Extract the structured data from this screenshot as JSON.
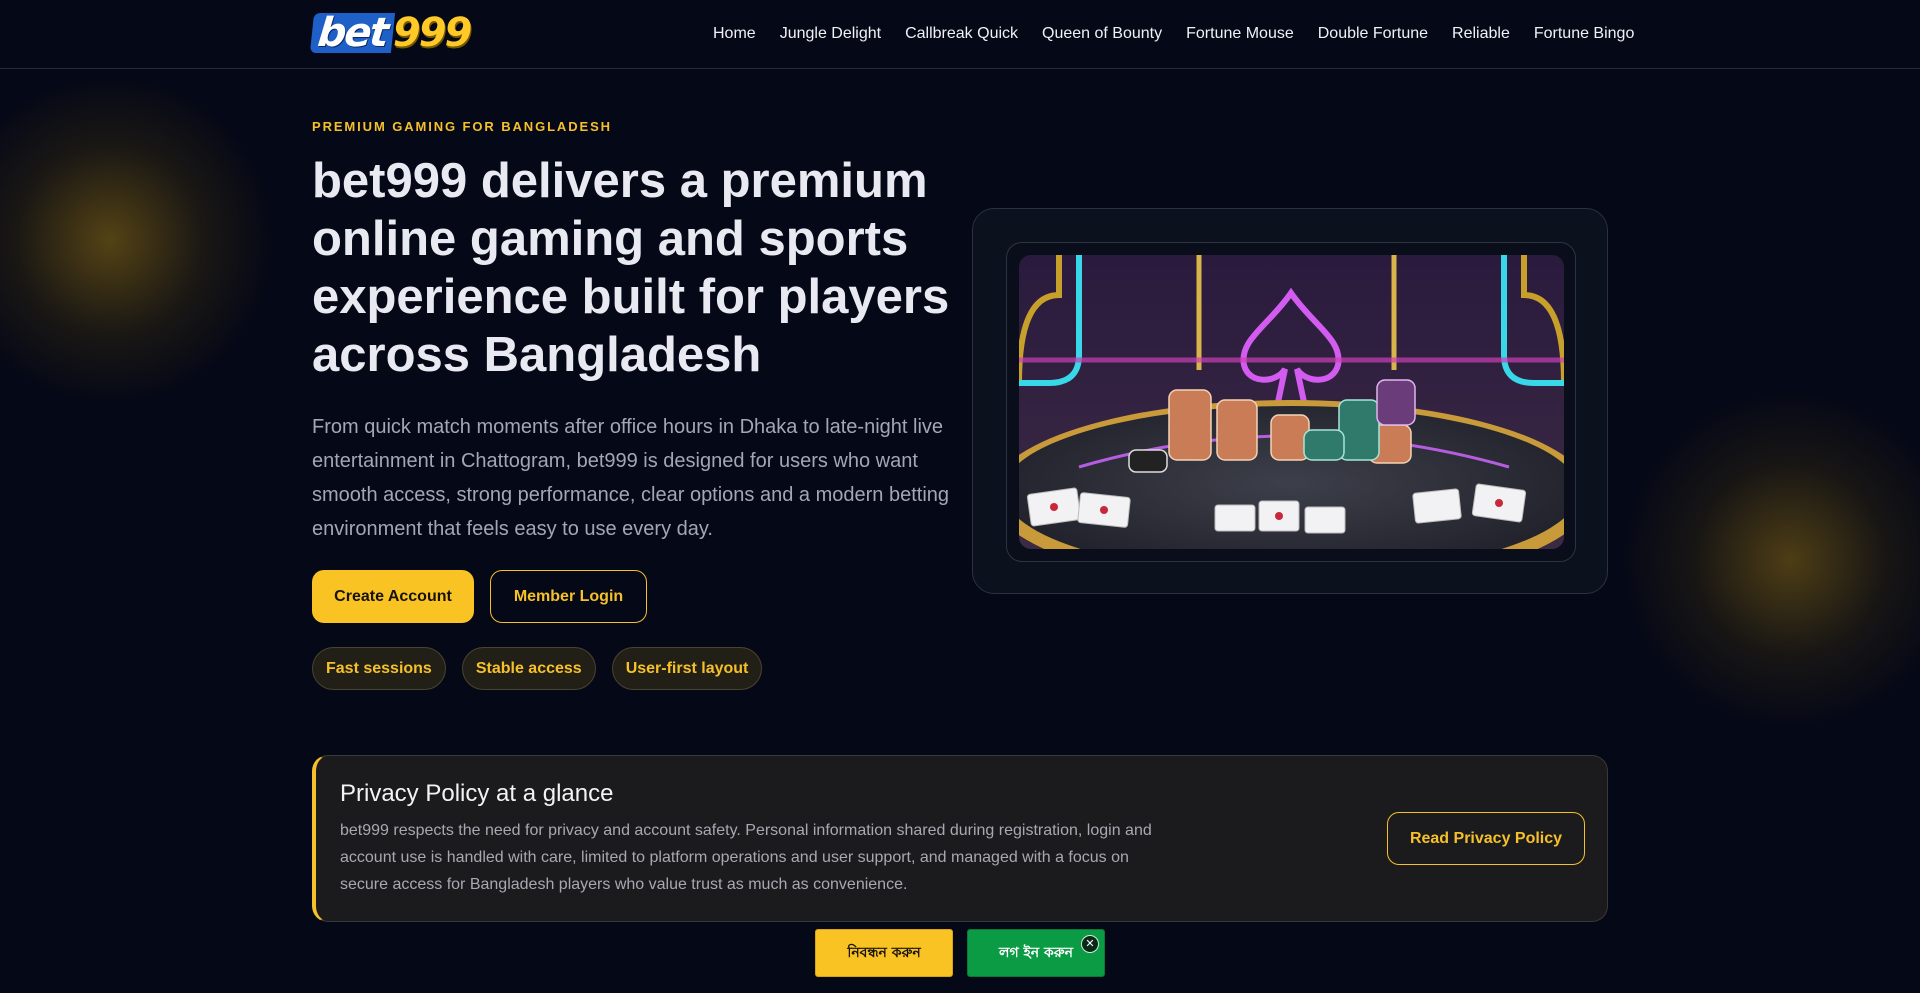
{
  "brand": {
    "logo_part1": "bet",
    "logo_part2": "999",
    "accent": "#f5c02a",
    "background": "#050816"
  },
  "nav": {
    "items": [
      {
        "label": "Home"
      },
      {
        "label": "Jungle Delight"
      },
      {
        "label": "Callbreak Quick"
      },
      {
        "label": "Queen of Bounty"
      },
      {
        "label": "Fortune Mouse"
      },
      {
        "label": "Double Fortune"
      },
      {
        "label": "Reliable"
      },
      {
        "label": "Fortune Bingo"
      }
    ]
  },
  "hero": {
    "eyebrow": "PREMIUM GAMING FOR BANGLADESH",
    "title": "bet999 delivers a premium online gaming and sports experience built for players across Bangladesh",
    "lead": "From quick match moments after office hours in Dhaka to late-night live entertainment in Chattogram, bet999 is designed for users who want smooth access, strong performance, clear options and a modern betting environment that feels easy to use every day.",
    "primary_cta": "Create Account",
    "secondary_cta": "Member Login",
    "chips": [
      {
        "label": "Fast sessions"
      },
      {
        "label": "Stable access"
      },
      {
        "label": "User-first layout"
      }
    ],
    "image_icon": "casino-table-illustration"
  },
  "privacy": {
    "title": "Privacy Policy at a glance",
    "body": "bet999 respects the need for privacy and account safety. Personal information shared during registration, login and account use is handled with care, limited to platform operations and user support, and managed with a focus on secure access for Bangladesh players who value trust as much as convenience.",
    "cta": "Read Privacy Policy"
  },
  "sticky": {
    "register": "নিবন্ধন করুন",
    "login": "লগ ইন করুন",
    "close_icon": "✕"
  }
}
